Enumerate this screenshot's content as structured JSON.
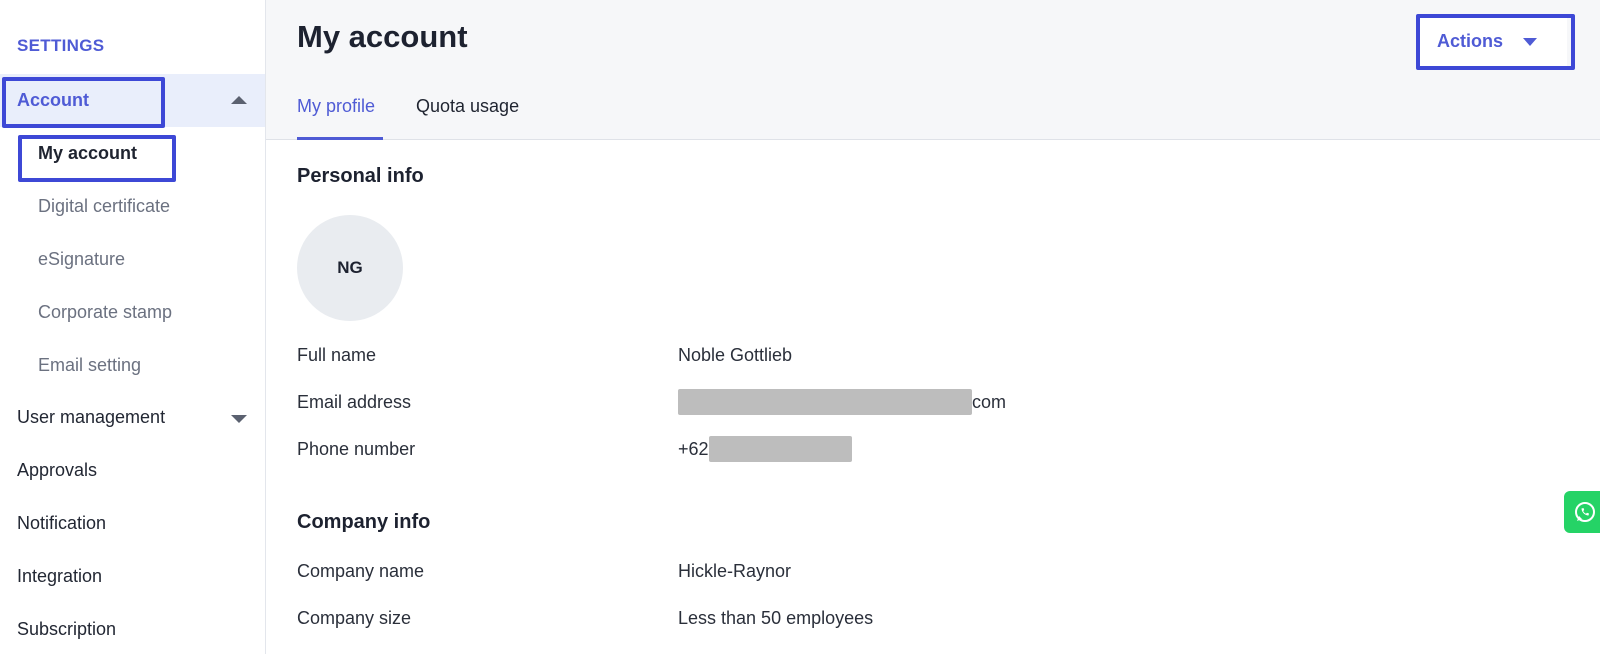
{
  "sidebar": {
    "heading": "SETTINGS",
    "account_label": "Account",
    "account_items": [
      {
        "label": "My account"
      },
      {
        "label": "Digital certificate"
      },
      {
        "label": "eSignature"
      },
      {
        "label": "Corporate stamp"
      },
      {
        "label": "Email setting"
      }
    ],
    "other_items": [
      {
        "label": "User management"
      },
      {
        "label": "Approvals"
      },
      {
        "label": "Notification"
      },
      {
        "label": "Integration"
      },
      {
        "label": "Subscription"
      }
    ]
  },
  "header": {
    "title": "My account",
    "actions_label": "Actions",
    "tabs": [
      {
        "label": "My profile",
        "active": true
      },
      {
        "label": "Quota usage",
        "active": false
      }
    ]
  },
  "personal_info": {
    "title": "Personal info",
    "avatar_initials": "NG",
    "full_name_label": "Full name",
    "full_name": "Noble Gottlieb",
    "email_label": "Email address",
    "email_visible_suffix": "com",
    "phone_label": "Phone number",
    "phone_visible_prefix": "+62"
  },
  "company_info": {
    "title": "Company info",
    "company_name_label": "Company name",
    "company_name": "Hickle-Raynor",
    "company_size_label": "Company size",
    "company_size": "Less than 50 employees"
  },
  "colors": {
    "accent": "#4f5bd5",
    "highlight": "#3d48d6",
    "whatsapp": "#25d366"
  },
  "icons": {
    "account_toggle": "chevron-up-icon",
    "user_management_toggle": "chevron-down-icon",
    "actions_caret": "caret-down-icon",
    "chat": "whatsapp-icon"
  }
}
